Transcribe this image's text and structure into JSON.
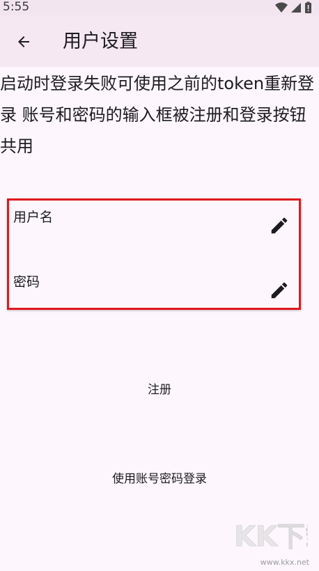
{
  "status_bar": {
    "time": "5:55",
    "icons": [
      "wifi-icon",
      "signal-icon",
      "battery-alert-icon"
    ]
  },
  "app_bar": {
    "back_icon": "arrow-back-icon",
    "title": "用户设置"
  },
  "description": "启动时登录失败可使用之前的token重新登录 账号和密码的输入框被注册和登录按钮共用",
  "fields": [
    {
      "label": "用户名",
      "icon": "edit-pencil-icon"
    },
    {
      "label": "密码",
      "icon": "edit-pencil-icon"
    }
  ],
  "buttons": {
    "register": "注册",
    "login": "使用账号密码登录"
  },
  "watermark": {
    "text": "www.kkx.net"
  },
  "colors": {
    "background": "#fdf7fd",
    "app_bar": "#f5e8f2",
    "highlight_border": "#e0171c"
  }
}
